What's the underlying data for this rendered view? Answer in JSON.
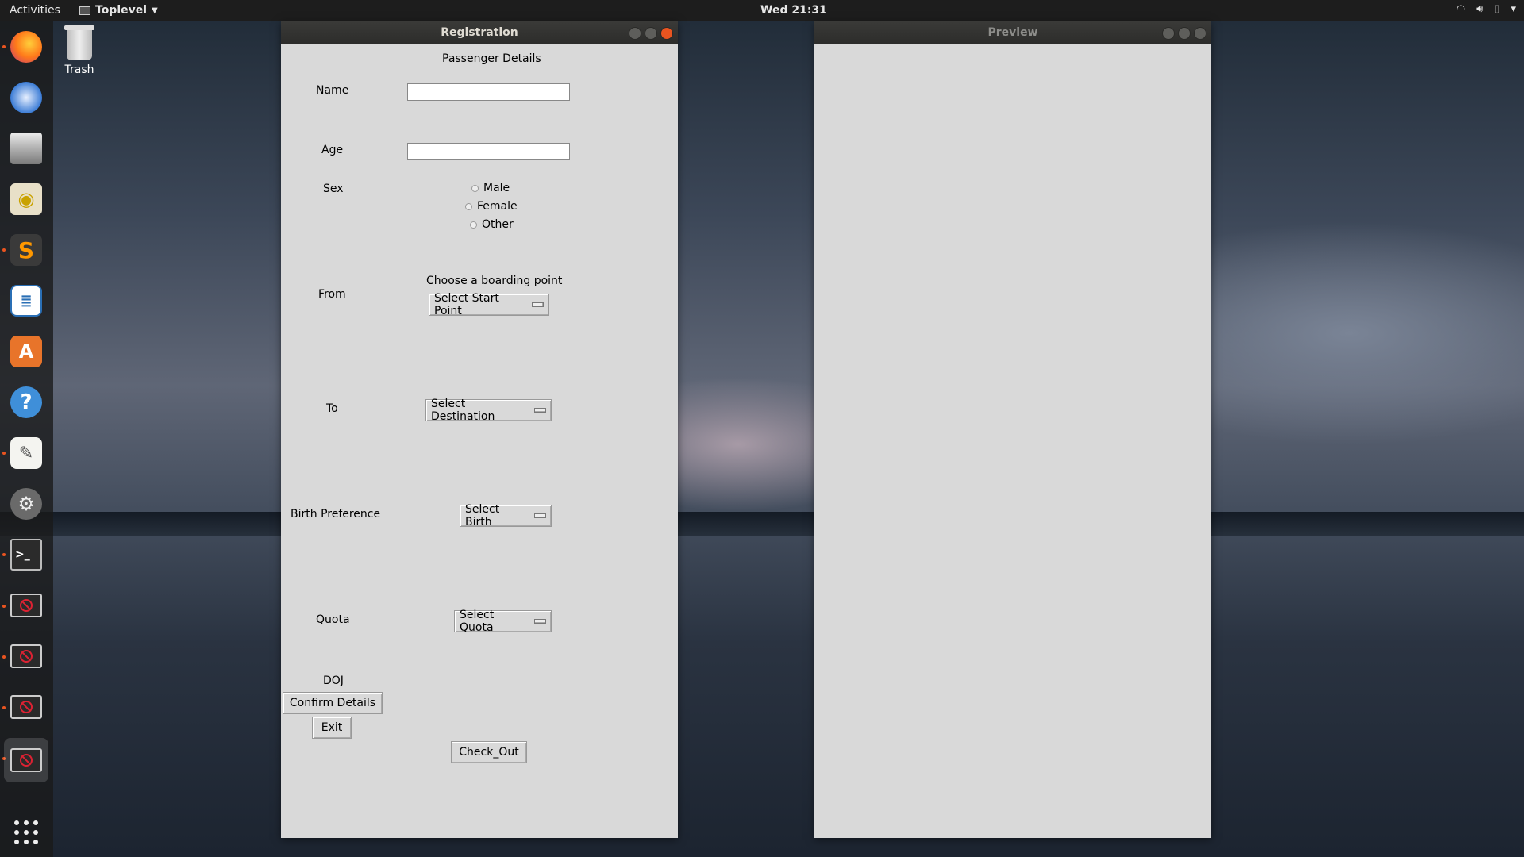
{
  "topbar": {
    "activities": "Activities",
    "app_name": "Toplevel",
    "clock": "Wed 21:31"
  },
  "desktop": {
    "trash_label": "Trash"
  },
  "dock": {
    "items": [
      "firefox-icon",
      "thunderbird-icon",
      "files-icon",
      "rhythmbox-icon",
      "sublime-text-icon",
      "libreoffice-writer-icon",
      "software-center-icon",
      "help-icon",
      "text-editor-icon",
      "settings-icon",
      "terminal-icon",
      "blocked-window-icon",
      "blocked-window-icon",
      "blocked-window-icon",
      "blocked-window-icon",
      "show-apps-icon"
    ]
  },
  "registration": {
    "title": "Registration",
    "heading": "Passenger Details",
    "name_label": "Name",
    "name_value": "",
    "age_label": "Age",
    "age_value": "",
    "sex_label": "Sex",
    "sex_options": [
      "Male",
      "Female",
      "Other"
    ],
    "from_label": "From",
    "boarding_prompt": "Choose a boarding point",
    "start_point": "Select Start Point",
    "to_label": "To",
    "destination": "Select Destination",
    "berth_label": "Birth Preference",
    "berth": "Select Birth",
    "quota_label": "Quota",
    "quota": "Select Quota",
    "doj_label": "DOJ",
    "confirm_button": "Confirm Details",
    "exit_button": "Exit",
    "checkout_button": "Check_Out"
  },
  "preview": {
    "title": "Preview"
  },
  "colors": {
    "accent": "#e95420",
    "window_bg": "#d9d9d9",
    "titlebar": "#2c2c2a"
  }
}
